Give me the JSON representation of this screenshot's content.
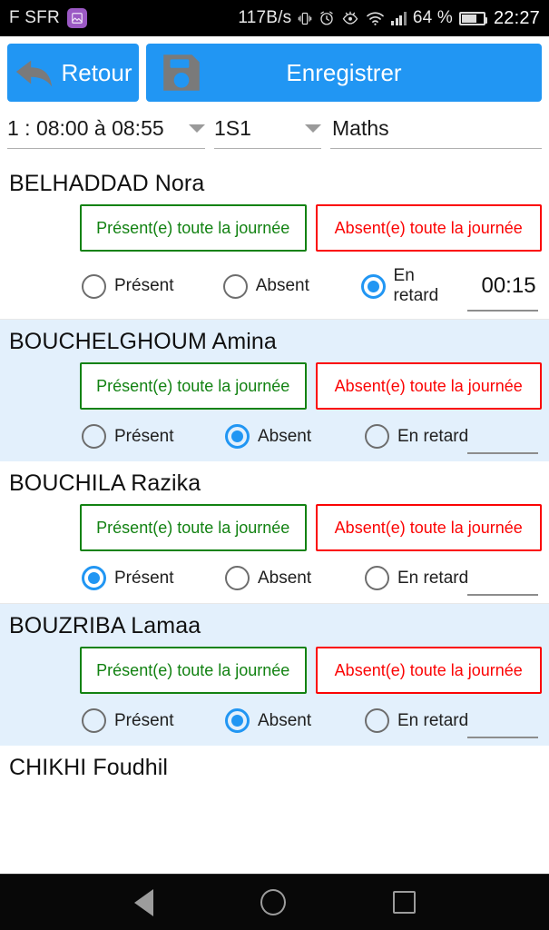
{
  "status_bar": {
    "carrier": "F SFR",
    "photo_badge_icon": "image-badge-icon",
    "network_speed": "117B/s",
    "vibrate_icon": "vibrate-icon",
    "alarm_icon": "alarm-clock-icon",
    "eye_icon": "eye-care-icon",
    "wifi_icon": "wifi-icon",
    "signal_icon": "cellular-signal-icon",
    "battery_percent": "64 %",
    "battery_icon": "battery-icon",
    "clock": "22:27"
  },
  "toolbar": {
    "back_label": "Retour",
    "back_icon": "back-arrow-icon",
    "save_label": "Enregistrer",
    "save_icon": "floppy-disk-save-icon",
    "accent_color": "#2196f3"
  },
  "selectors": {
    "period": "1 : 08:00 à 08:55",
    "classroom": "1S1",
    "subject": "Maths",
    "arrow_icon": "chevron-down-icon"
  },
  "labels": {
    "present_all_day": "Présent(e) toute la journée",
    "absent_all_day": "Absent(e) toute la journée",
    "present": "Présent",
    "absent": "Absent",
    "late": "En retard"
  },
  "colors": {
    "present_green": "#128212",
    "absent_red": "#fb0404",
    "selected_blue": "#2196f3",
    "alt_row_bg": "#e3f0fc"
  },
  "students": [
    {
      "name": "BELHADDAD Nora",
      "status": "late",
      "late_time": "00:15",
      "alt_row": false,
      "has_controls": true
    },
    {
      "name": "BOUCHELGHOUM Amina",
      "status": "absent",
      "late_time": "",
      "alt_row": true,
      "has_controls": true
    },
    {
      "name": "BOUCHILA Razika",
      "status": "present",
      "late_time": "",
      "alt_row": false,
      "has_controls": true
    },
    {
      "name": "BOUZRIBA Lamaa",
      "status": "absent",
      "late_time": "",
      "alt_row": true,
      "has_controls": true
    },
    {
      "name": "CHIKHI Foudhil",
      "status": "",
      "late_time": "",
      "alt_row": false,
      "has_controls": false
    }
  ],
  "navbar": {
    "back_icon": "nav-back-triangle-icon",
    "home_icon": "nav-home-circle-icon",
    "recents_icon": "nav-recents-square-icon"
  }
}
